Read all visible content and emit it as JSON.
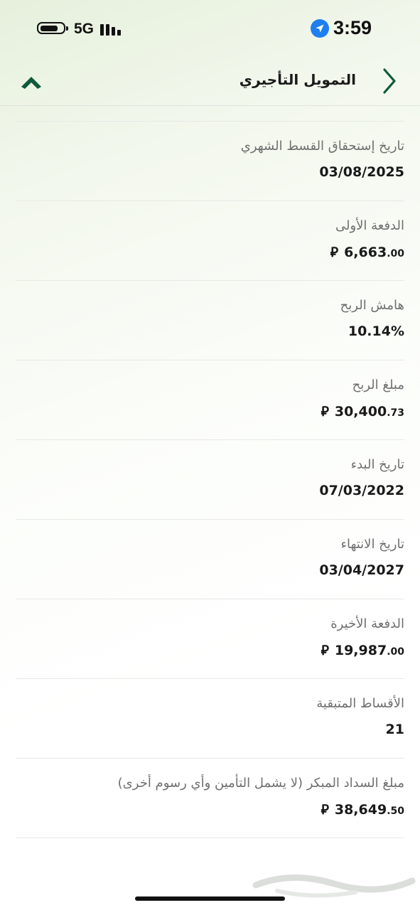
{
  "status_bar": {
    "time": "3:59",
    "network": "5G",
    "icons": [
      "battery-icon",
      "signal-icon",
      "location-arrow-icon"
    ]
  },
  "header": {
    "title": "التمويل التأجيري",
    "back_icon": "chevron-right-icon",
    "collapse_icon": "chevron-up-icon",
    "accent_color": "#0f5a3a"
  },
  "details": [
    {
      "label": "تاريخ إستحقاق القسط الشهري",
      "value": "03/08/2025"
    },
    {
      "label": "الدفعة الأولى",
      "value": "6,663",
      "decimals": ".00",
      "currency": "riyal-icon"
    },
    {
      "label": "هامش الربح",
      "value": "10.14%"
    },
    {
      "label": "مبلغ الربح",
      "value": "30,400",
      "decimals": ".73",
      "currency": "riyal-icon"
    },
    {
      "label": "تاريخ البدء",
      "value": "07/03/2022"
    },
    {
      "label": "تاريخ الانتهاء",
      "value": "03/04/2027"
    },
    {
      "label": "الدفعة الأخيرة",
      "value": "19,987",
      "decimals": ".00",
      "currency": "riyal-icon"
    },
    {
      "label": "الأقساط المتبقية",
      "value": "21"
    },
    {
      "label": "مبلغ السداد المبكر (لا يشمل التأمين وأي رسوم أخرى)",
      "value": "38,649",
      "decimals": ".50",
      "currency": "riyal-icon"
    }
  ],
  "watermark": {
    "text": "حراج"
  }
}
